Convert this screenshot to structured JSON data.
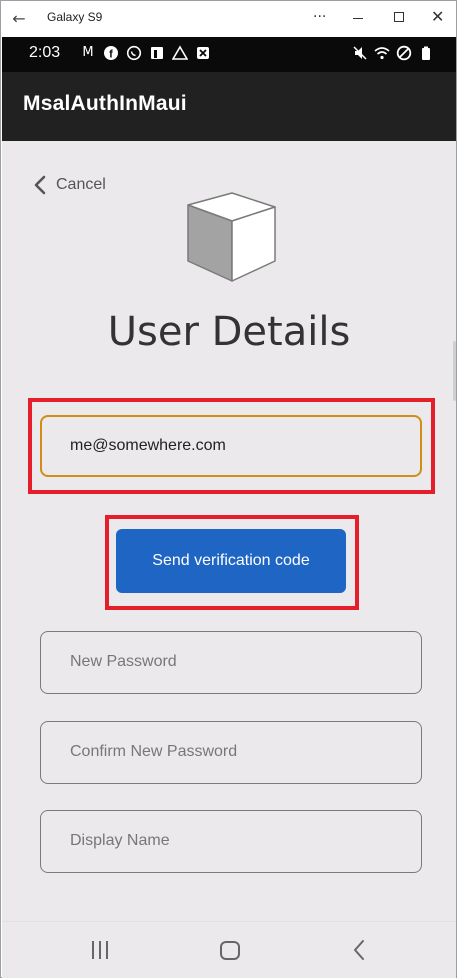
{
  "window": {
    "title": "Galaxy S9",
    "more_label": "···"
  },
  "status_bar": {
    "time": "2:03",
    "left_icons": [
      "gmail-icon",
      "facebook-icon",
      "whatsapp-icon",
      "app-icon",
      "drive-icon",
      "close-box-icon"
    ],
    "right_icons": [
      "mute-icon",
      "wifi-icon",
      "dnd-icon",
      "battery-icon"
    ]
  },
  "app": {
    "title": "MsalAuthInMaui"
  },
  "page": {
    "cancel_label": "Cancel",
    "heading": "User Details",
    "email_value": "me@somewhere.com",
    "send_button_label": "Send verification code",
    "new_password_placeholder": "New Password",
    "confirm_password_placeholder": "Confirm New Password",
    "display_name_placeholder": "Display Name"
  },
  "colors": {
    "highlight": "#e41e2b",
    "email_border": "#d18d16",
    "button": "#1f65c3",
    "appbar": "#212121",
    "background": "#ece9ec"
  }
}
